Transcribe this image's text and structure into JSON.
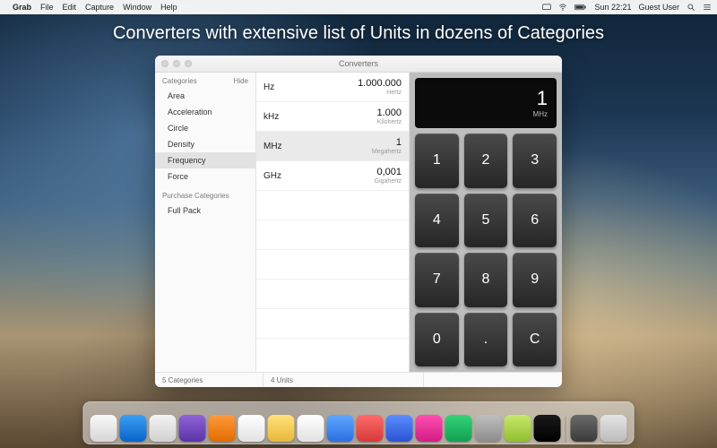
{
  "menubar": {
    "app": "Grab",
    "items": [
      "File",
      "Edit",
      "Capture",
      "Window",
      "Help"
    ],
    "status_time": "Sun 22:21",
    "user": "Guest User"
  },
  "headline": "Converters with extensive list of Units in dozens of Categories",
  "window_title": "Converters",
  "sidebar": {
    "header": "Categories",
    "hide_label": "Hide",
    "items": [
      {
        "label": "Area"
      },
      {
        "label": "Acceleration"
      },
      {
        "label": "Circle"
      },
      {
        "label": "Density"
      },
      {
        "label": "Frequency",
        "selected": true
      },
      {
        "label": "Force"
      }
    ],
    "purchase_header": "Purchase Categories",
    "purchase_items": [
      {
        "label": "Full Pack"
      }
    ]
  },
  "units": [
    {
      "abbr": "Hz",
      "value": "1.000.000",
      "name": "Hertz"
    },
    {
      "abbr": "kHz",
      "value": "1.000",
      "name": "Kilohertz"
    },
    {
      "abbr": "MHz",
      "value": "1",
      "name": "Megahertz",
      "selected": true
    },
    {
      "abbr": "GHz",
      "value": "0,001",
      "name": "Gigahertz"
    }
  ],
  "display": {
    "value": "1",
    "unit": "MHz"
  },
  "keys": [
    "1",
    "2",
    "3",
    "4",
    "5",
    "6",
    "7",
    "8",
    "9",
    "0",
    ".",
    "C"
  ],
  "status": {
    "categories": "5 Categories",
    "units": "4 Units"
  },
  "dock_colors": [
    "linear-gradient(#f8f8f8,#d6d6d6)",
    "linear-gradient(#3aa0f3,#0a63c9)",
    "linear-gradient(#f3f3f3,#d0d0d0)",
    "linear-gradient(#8f64d8,#5a34a6)",
    "linear-gradient(#ff9a3c,#e06c00)",
    "linear-gradient(#ffffff,#e2e2e2)",
    "linear-gradient(#ffe27a,#e8b73b)",
    "linear-gradient(#ffffff,#e2e2e2)",
    "linear-gradient(#5ea8ff,#2b6fe0)",
    "linear-gradient(#ff6a6a,#d63a3a)",
    "linear-gradient(#5c8dff,#2b52d4)",
    "linear-gradient(#ff4fb0,#d11d85)",
    "linear-gradient(#34d37a,#12a050)",
    "linear-gradient(#bfbfbf,#8c8c8c)",
    "linear-gradient(#c7e86b,#8fbf2f)",
    "linear-gradient(#1a1a1a,#000)",
    "linear-gradient(#6a6a6a,#3a3a3a)",
    "linear-gradient(#e4e4e4,#bcbcbc)"
  ]
}
